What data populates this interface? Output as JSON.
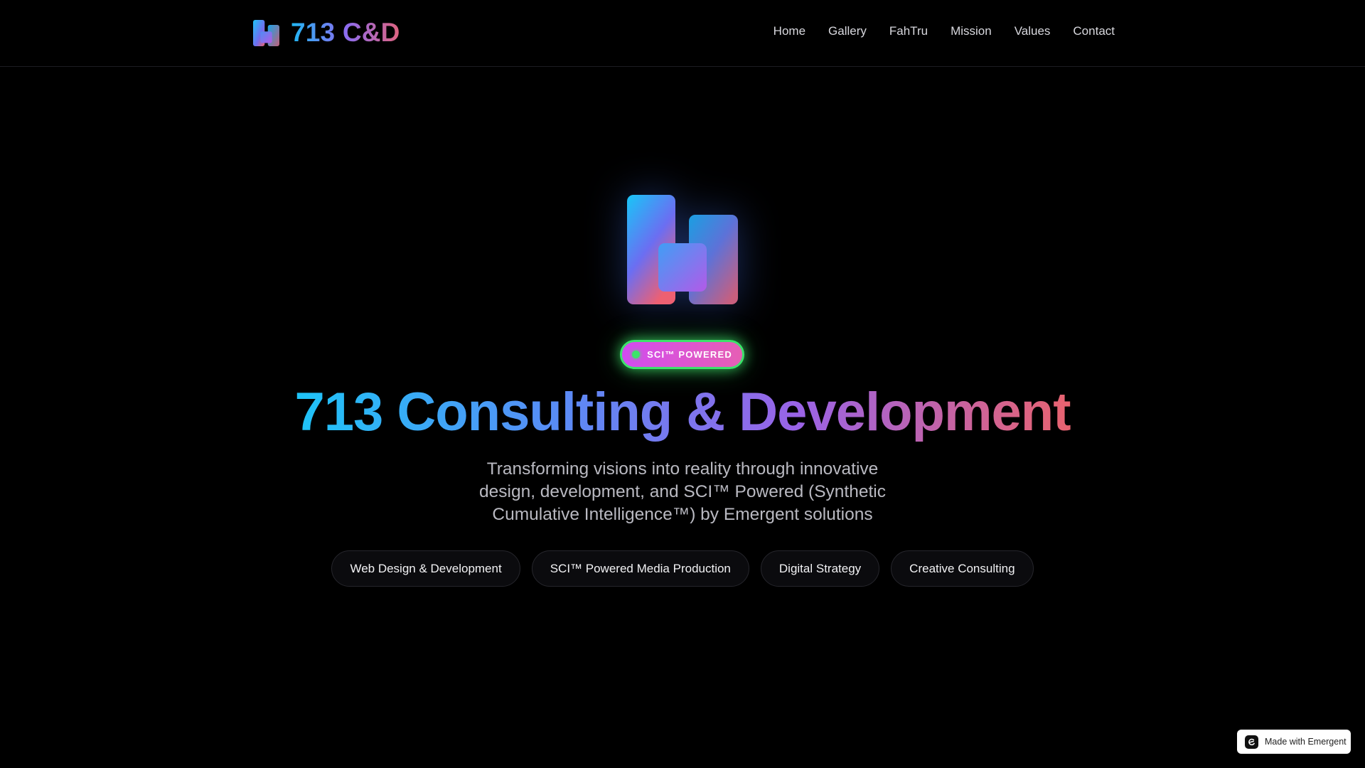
{
  "header": {
    "brand_name": "713 C&D",
    "logo_icon": "brand-logo-icon",
    "nav": [
      {
        "label": "Home"
      },
      {
        "label": "Gallery"
      },
      {
        "label": "FahTru"
      },
      {
        "label": "Mission"
      },
      {
        "label": "Values"
      },
      {
        "label": "Contact"
      }
    ]
  },
  "hero": {
    "logo_icon": "brand-logo-icon",
    "badge": "SCI™ POWERED",
    "title": "713 Consulting & Development",
    "subtitle": "Transforming visions into reality through innovative design, development, and SCI™ Powered (Synthetic Cumulative Intelligence™) by Emergent solutions",
    "services": [
      {
        "label": "Web Design & Development"
      },
      {
        "label": "SCI™ Powered Media Production"
      },
      {
        "label": "Digital Strategy"
      },
      {
        "label": "Creative Consulting"
      }
    ]
  },
  "footer_badge": {
    "label": "Made with Emergent",
    "icon": "emergent-icon"
  },
  "colors": {
    "background": "#000000",
    "gradient_start": "#1ec4f7",
    "gradient_mid": "#9a63e6",
    "gradient_end": "#e8636f",
    "badge_glow": "#3ce36a"
  }
}
